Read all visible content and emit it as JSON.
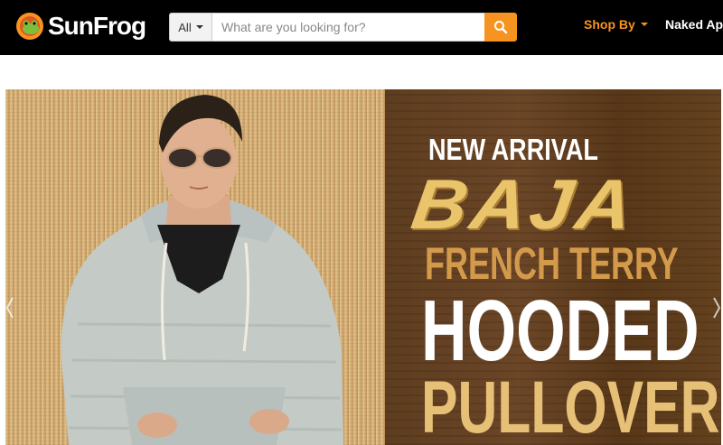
{
  "header": {
    "logo_text": "SunFrog",
    "search": {
      "category": "All",
      "placeholder": "What are you looking for?",
      "value": ""
    },
    "nav": {
      "shop_by": "Shop By",
      "naked_apparel": "Naked Apparel"
    }
  },
  "hero": {
    "line1": "NEW ARRIVAL",
    "line2": "BAJA",
    "line3": "FRENCH TERRY",
    "line4": "HOODED",
    "line5": "PULLOVER"
  },
  "colors": {
    "header_bg": "#000000",
    "accent": "#f79421",
    "logo_green": "#7cbf3a"
  },
  "icons": [
    "sunfrog-logo-icon",
    "chevron-down-icon",
    "search-icon",
    "slide-prev-icon",
    "slide-next-icon"
  ]
}
